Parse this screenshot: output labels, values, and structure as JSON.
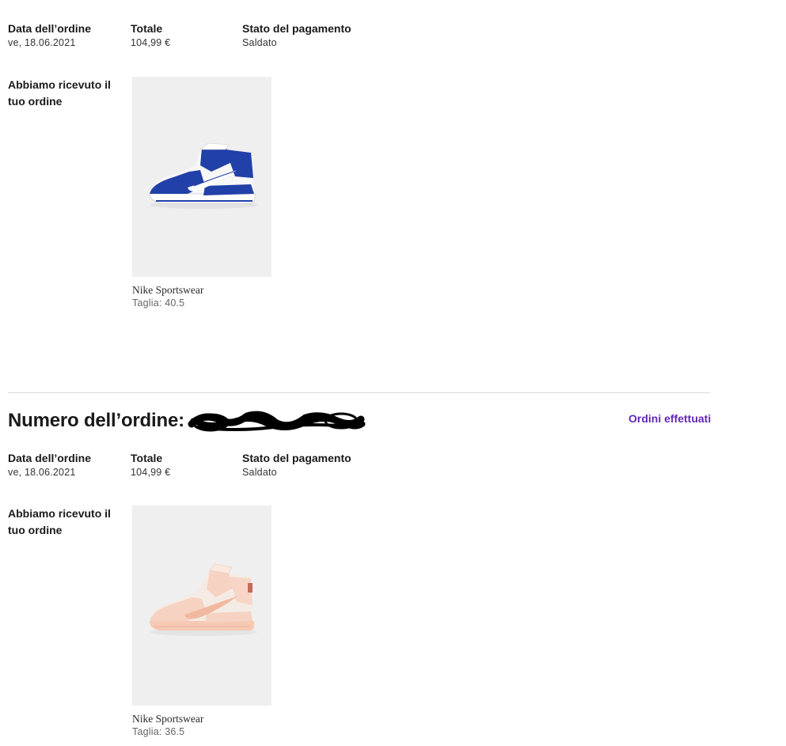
{
  "orders": [
    {
      "meta": {
        "date_label": "Data dell’ordine",
        "date_value": "ve, 18.06.2021",
        "total_label": "Totale",
        "total_value": "104,99 €",
        "payment_label": "Stato del pagamento",
        "payment_value": "Saldato"
      },
      "status": "Abbiamo ricevuto il tuo ordine",
      "product": {
        "brand": "Nike Sportswear",
        "size": "Taglia: 40.5",
        "image_icon": "blue-white-high-top-sneaker"
      }
    },
    {
      "header": {
        "title": "Numero dell’ordine:",
        "link": "Ordini effettuati"
      },
      "meta": {
        "date_label": "Data dell’ordine",
        "date_value": "ve, 18.06.2021",
        "total_label": "Totale",
        "total_value": "104,99 €",
        "payment_label": "Stato del pagamento",
        "payment_value": "Saldato"
      },
      "status": "Abbiamo ricevuto il tuo ordine",
      "product": {
        "brand": "Nike Sportswear",
        "size": "Taglia: 36.5",
        "image_icon": "peach-white-high-top-sneaker"
      }
    }
  ],
  "colors": {
    "accent_link": "#6328b8",
    "image_background": "#efefef",
    "sneaker_blue": "#2140a8",
    "sneaker_peach": "#f6c9b4"
  }
}
